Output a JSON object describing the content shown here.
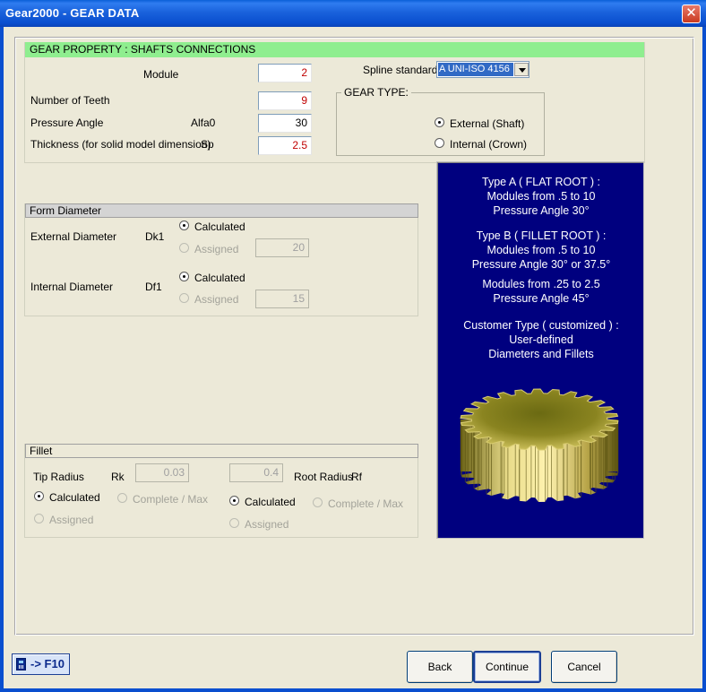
{
  "window": {
    "title": "Gear2000 - GEAR DATA",
    "close_symbol": "✕"
  },
  "header": {
    "title": "GEAR PROPERTY : SHAFTS CONNECTIONS"
  },
  "fields": {
    "module": {
      "label": "Module",
      "value": "2"
    },
    "teeth": {
      "label": "Number of Teeth",
      "value": "9"
    },
    "pressure": {
      "label": "Pressure Angle",
      "symbol": "Alfa0",
      "value": "30"
    },
    "thickness": {
      "label": "Thickness (for solid model dimension)",
      "symbol": "Sp",
      "value": "2.5"
    }
  },
  "spline": {
    "label": "Spline standard",
    "selected": "A UNI-ISO 4156"
  },
  "gear_type": {
    "legend": "GEAR TYPE:",
    "external": "External (Shaft)",
    "internal": "Internal (Crown)"
  },
  "form_diameter": {
    "title": "Form Diameter",
    "external": {
      "label": "External Diameter",
      "symbol": "Dk1",
      "calculated": "Calculated",
      "assigned": "Assigned",
      "value": "20"
    },
    "internal": {
      "label": "Internal Diameter",
      "symbol": "Df1",
      "calculated": "Calculated",
      "assigned": "Assigned",
      "value": "15"
    }
  },
  "fillet": {
    "title": "Fillet",
    "tip": {
      "label": "Tip Radius",
      "symbol": "Rk",
      "value": "0.03",
      "calculated": "Calculated",
      "complete": "Complete / Max",
      "assigned": "Assigned"
    },
    "root": {
      "label": "Root Radius",
      "symbol": "Rf",
      "value": "0.4",
      "calculated": "Calculated",
      "complete": "Complete / Max",
      "assigned": "Assigned"
    }
  },
  "info": {
    "lines": [
      "Type A  ( FLAT ROOT ) :",
      "Modules  from .5  to 10",
      "Pressure Angle 30°",
      "Type B  ( FILLET ROOT ) :",
      "Modules  from .5  to 10",
      "Pressure Angle 30° or 37.5°",
      "Modules  from .25  to 2.5",
      "Pressure Angle 45°",
      "Customer Type  ( customized ) :",
      "User-defined",
      "Diameters and Fillets"
    ]
  },
  "buttons": {
    "back": "Back",
    "continue": "Continue",
    "cancel": "Cancel",
    "calc": "-> F10"
  },
  "colors": {
    "info_bg": "#00007f",
    "header_green": "#8fee8f",
    "value_red": "#c00000"
  },
  "icons": {
    "calculator": "calculator-icon",
    "gear": "gear-image",
    "close": "close-icon"
  }
}
